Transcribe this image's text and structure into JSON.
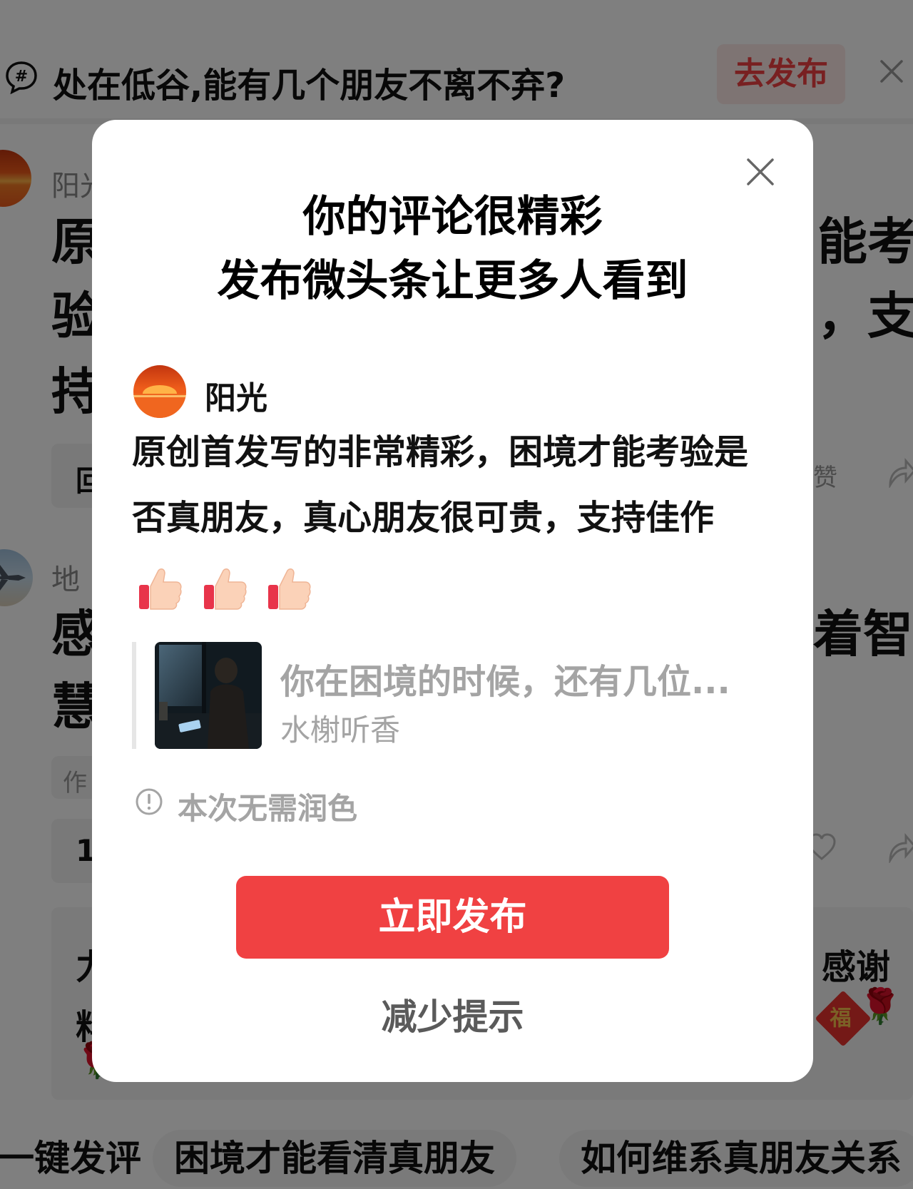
{
  "topic_bar": {
    "title": "处在低谷,能有几个朋友不离不弃?",
    "publish_label": "去发布"
  },
  "background_feed": {
    "comment1_name_partial": "阳光",
    "comment1_left_lines": [
      "原",
      "验",
      "持"
    ],
    "comment1_right_lines": [
      "能考",
      "，支"
    ],
    "comment1_action_left": "回",
    "comment1_like_label": "赞",
    "comment2_name_partial": "地",
    "comment2_left_lines": [
      "感",
      "慧"
    ],
    "comment2_right_line": "着智",
    "comment2_tag_partial": "作",
    "count_partial": "1",
    "card_text_left": [
      "力",
      "料"
    ],
    "card_text_right": "感谢",
    "fu_char": "福"
  },
  "dialog": {
    "title_line1": "你的评论很精彩",
    "title_line2": "发布微头条让更多人看到",
    "author": "阳光",
    "comment": "原创首发写的非常精彩，困境才能考验是否真朋友，真心朋友很可贵，支持佳作",
    "quoted_article": {
      "title": "你在困境的时候，还有几位...",
      "author": "水榭听香"
    },
    "notice": "本次无需润色",
    "publish_button": "立即发布",
    "reduce_link": "减少提示"
  },
  "suggestion_chips": [
    "一键发评",
    "困境才能看清真朋友",
    "如何维系真朋友关系"
  ],
  "colors": {
    "accent_red": "#f04142",
    "overlay": "rgba(0,0,0,0.5)",
    "muted_text": "#a4a4a4"
  },
  "icons": [
    "hashtag-comment-icon",
    "close-icon",
    "thumbs-up-icon",
    "info-icon",
    "heart-icon",
    "share-icon",
    "rose-icon"
  ]
}
